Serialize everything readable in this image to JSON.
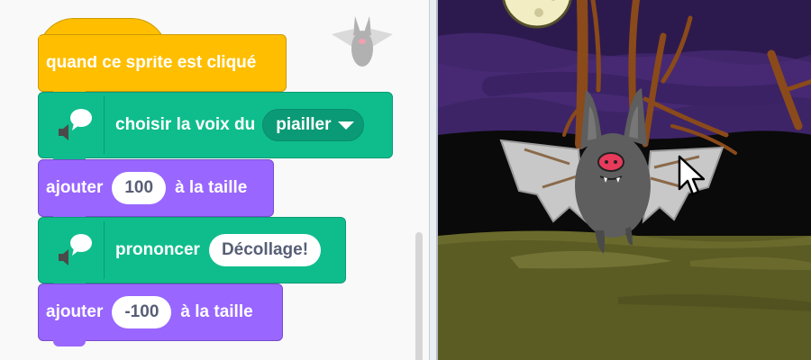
{
  "blocks": {
    "hat": {
      "label": "quand ce sprite est cliqué"
    },
    "set_voice": {
      "label": "choisir la voix du",
      "value": "piailler"
    },
    "change_size_1": {
      "prefix": "ajouter",
      "value": "100",
      "suffix": "à la taille"
    },
    "speak": {
      "label": "prononcer",
      "value": "Décollage!"
    },
    "change_size_2": {
      "prefix": "ajouter",
      "value": "-100",
      "suffix": "à la taille"
    }
  },
  "colors": {
    "events": "#ffbf00",
    "text_to_speech": "#0fbd8c",
    "looks": "#9966ff",
    "night_sky": "#3d2466",
    "ground": "#5b5b24"
  },
  "icons": [
    "speech-extension-icon",
    "cursor-arrow-icon",
    "bat-sprite-thumbnail-icon"
  ]
}
